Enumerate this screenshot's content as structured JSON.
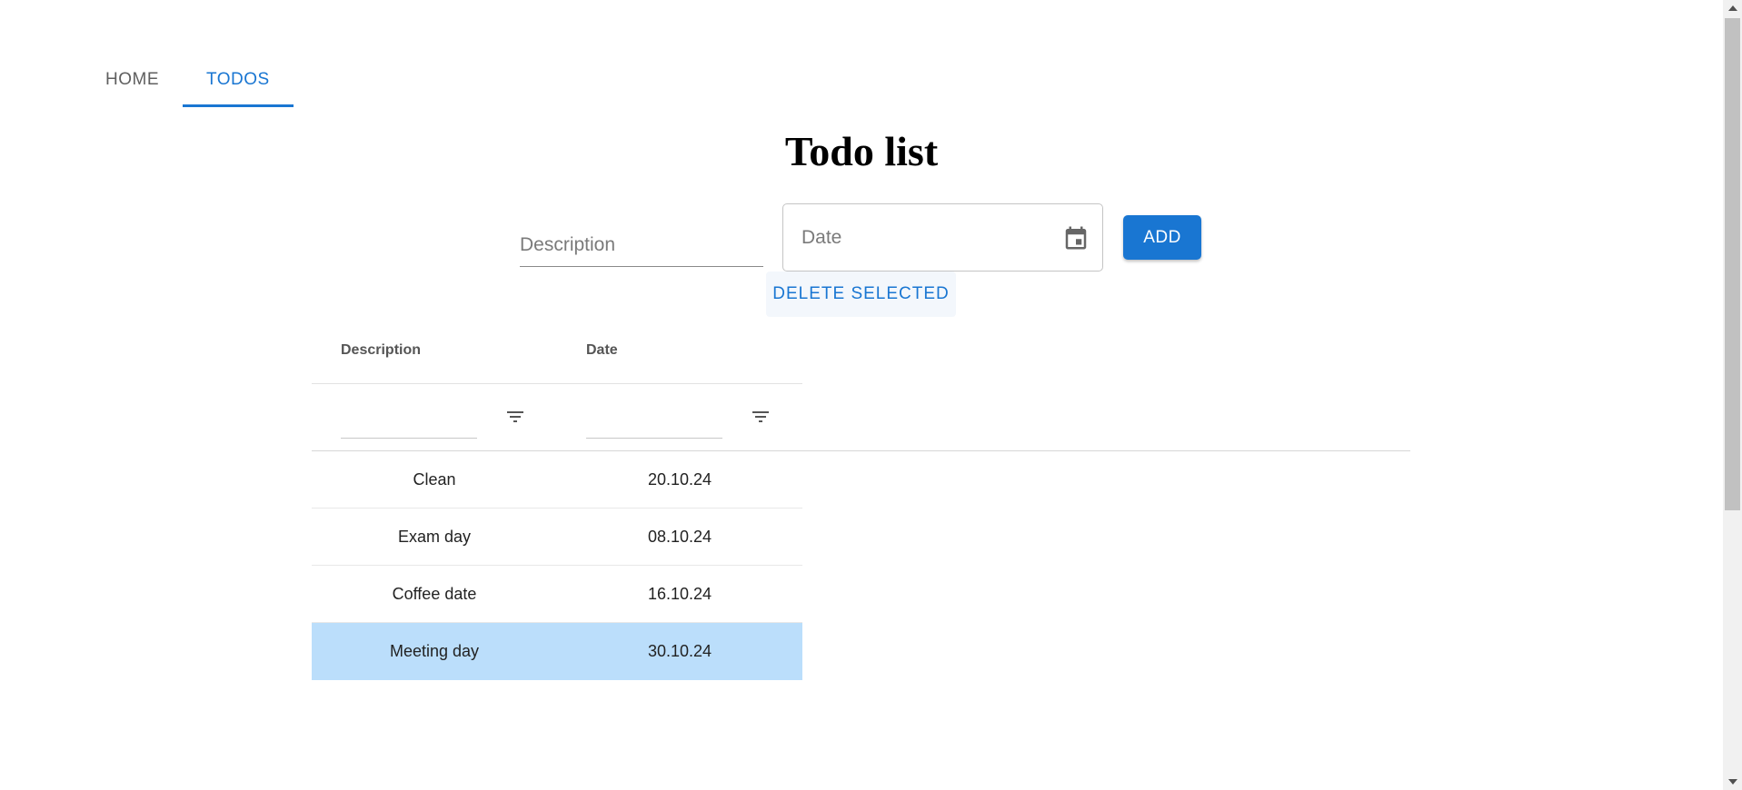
{
  "tabs": [
    {
      "label": "HOME",
      "active": false
    },
    {
      "label": "TODOS",
      "active": true
    }
  ],
  "title": "Todo list",
  "form": {
    "description_placeholder": "Description",
    "date_placeholder": "Date",
    "add_label": "ADD",
    "delete_label": "DELETE SELECTED"
  },
  "grid": {
    "columns": [
      "Description",
      "Date"
    ],
    "rows": [
      {
        "description": "Clean",
        "date": "20.10.24",
        "selected": false
      },
      {
        "description": "Exam day",
        "date": "08.10.24",
        "selected": false
      },
      {
        "description": "Coffee date",
        "date": "16.10.24",
        "selected": false
      },
      {
        "description": "Meeting day",
        "date": "30.10.24",
        "selected": true
      }
    ]
  },
  "icons": {
    "calendar": "calendar-icon",
    "filter": "filter-icon"
  },
  "colors": {
    "accent": "#1976d2",
    "selected_row": "#bbdefb",
    "tab_inactive": "#5f5f5f"
  }
}
